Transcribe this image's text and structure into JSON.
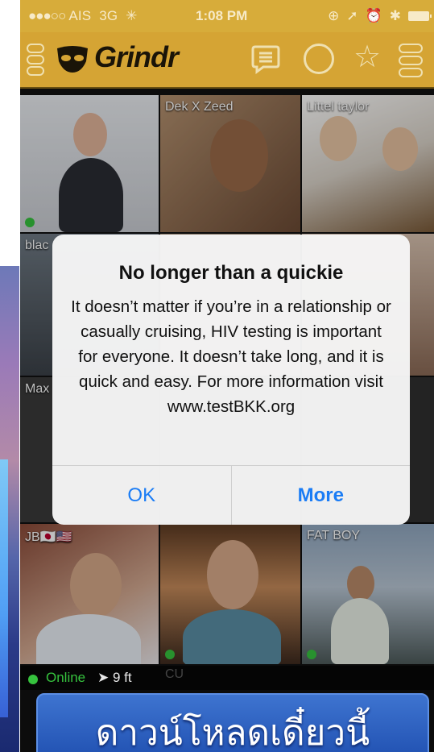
{
  "status_bar": {
    "signal_dots": "●●●○○",
    "carrier": "AIS",
    "network": "3G",
    "activity": "✳",
    "time": "1:08 PM",
    "status_icons": [
      "⊕",
      "➚",
      "⏰",
      "✱"
    ]
  },
  "navbar": {
    "app_name": "Grindr",
    "icons": [
      "menu-icon",
      "grindr-mask-icon",
      "chat-icon",
      "circle-icon",
      "star-icon",
      "filter-icon"
    ]
  },
  "grid": {
    "tiles": [
      {
        "name": "",
        "online": true
      },
      {
        "name": "Dek X Zeed",
        "online": false
      },
      {
        "name": "Littel taylor",
        "online": false
      },
      {
        "name": "blac",
        "online": false
      },
      {
        "name": "Max",
        "online": false
      },
      {
        "name": "JB🇯🇵🇺🇸",
        "online": false
      },
      {
        "name": "",
        "online": true
      },
      {
        "name": "FAT BOY",
        "online": true
      }
    ]
  },
  "alert": {
    "title": "No longer than a quickie",
    "message": "It doesn’t matter if you’re in a relationship or casually cruising, HIV testing is important for everyone.  It doesn’t take long, and it is quick and easy. For more information visit www.testBKK.org",
    "ok_label": "OK",
    "more_label": "More"
  },
  "bottom": {
    "online_label": "Online",
    "distance": "9 ft",
    "partial_text": "CU",
    "banner_text": "ดาวน์โหลดเดี๋ยวนี้"
  },
  "colors": {
    "navbar_gold": "#d5a434",
    "online_green": "#36c23e",
    "link_blue": "#1a7cf5",
    "banner_blue": "#2f62c4"
  }
}
